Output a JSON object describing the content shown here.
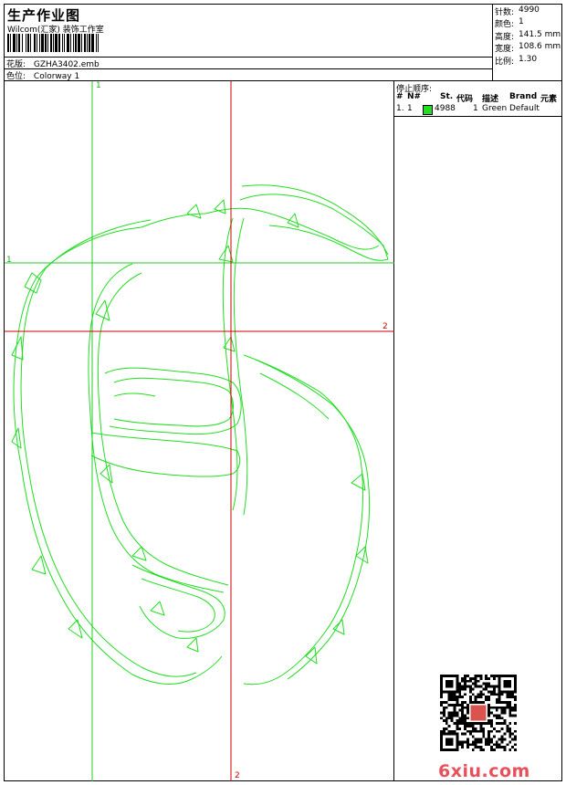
{
  "title": "生产作业图",
  "company": "Wilcom(汇家) 装饰工作室",
  "rows": [
    {
      "label": "花版:",
      "value": "GZHA3402.emb"
    },
    {
      "label": "色位:",
      "value": "Colorway 1"
    }
  ],
  "stats": [
    {
      "label": "针数:",
      "value": "4990"
    },
    {
      "label": "颜色:",
      "value": "1"
    },
    {
      "label": "高度:",
      "value": "141.5 mm"
    },
    {
      "label": "宽度:",
      "value": "108.6 mm"
    },
    {
      "label": "比例:",
      "value": "1.30"
    }
  ],
  "stop_sequence": {
    "title": "停止顺序:",
    "columns": [
      "#",
      "N#",
      "St.",
      "代码",
      "描述",
      "Brand",
      "元素"
    ],
    "rows": [
      {
        "index": "1.",
        "n": "1",
        "color": "#22dd22",
        "stitches": "4988",
        "code": "1",
        "desc": "Green",
        "brand": "Default"
      }
    ]
  },
  "guides": {
    "green_label_1": "1",
    "green_label_2": "1",
    "red_label_1": "2",
    "red_label_2": "2"
  },
  "colors": {
    "thread": "#22dd22",
    "guide_green": "#22cc22",
    "guide_red": "#cc0000",
    "watermark": "#e8505b"
  },
  "watermark": "6xiu.com"
}
